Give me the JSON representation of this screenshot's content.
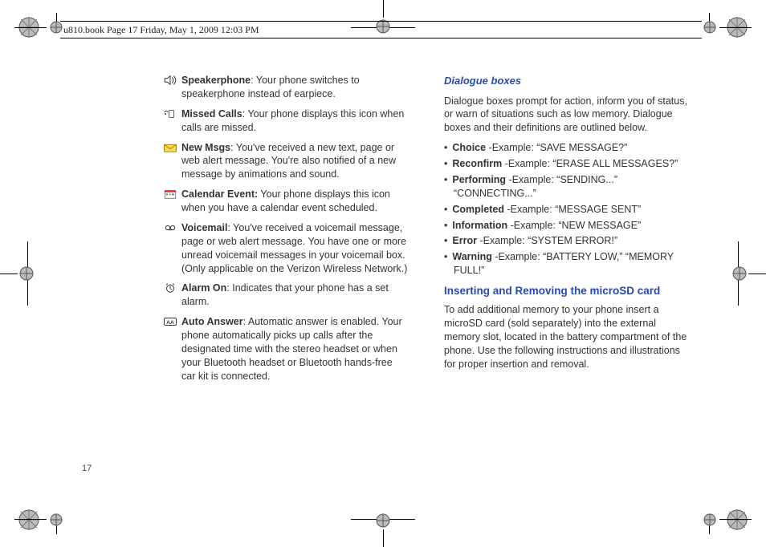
{
  "header": {
    "text": "u810.book  Page 17  Friday, May 1, 2009  12:03 PM"
  },
  "pagenum": "17",
  "left": {
    "items": [
      {
        "name": "speakerphone",
        "label": "Speakerphone",
        "sep": ": ",
        "text": "Your phone switches to speakerphone instead of earpiece."
      },
      {
        "name": "missed-calls",
        "label": "Missed Calls",
        "sep": ": ",
        "text": "Your phone displays this icon when calls are missed."
      },
      {
        "name": "new-msgs",
        "label": "New Msgs",
        "sep": ": ",
        "text": "You've received a new text, page or web alert message. You're also notified of a new message by animations and sound."
      },
      {
        "name": "calendar-event",
        "label": "Calendar Event:",
        "sep": " ",
        "text": "Your phone displays this icon when you have a calendar event scheduled."
      },
      {
        "name": "voicemail",
        "label": "Voicemail",
        "sep": ": ",
        "text": "You've received a voicemail message, page or web alert message. You have one or more unread voicemail messages in your voicemail box. (Only applicable on the Verizon Wireless Network.)"
      },
      {
        "name": "alarm-on",
        "label": "Alarm On",
        "sep": ": ",
        "text": "Indicates that your phone has a set alarm."
      },
      {
        "name": "auto-answer",
        "label": "Auto Answer",
        "sep": ": ",
        "text": "Automatic answer is enabled. Your phone automatically picks up calls after the designated time with the stereo headset or when your Bluetooth headset or Bluetooth hands-free car kit is connected."
      }
    ]
  },
  "right": {
    "heading1": "Dialogue boxes",
    "intro": "Dialogue boxes prompt for action, inform you of status, or warn of situations such as low memory. Dialogue boxes and their definitions are outlined below.",
    "bullets": [
      {
        "label": "Choice",
        "text": " -Example: “SAVE MESSAGE?”"
      },
      {
        "label": "Reconfirm",
        "text": " -Example: “ERASE ALL MESSAGES?”"
      },
      {
        "label": "Performing",
        "text": " -Example: “SENDING...” “CONNECTING...”"
      },
      {
        "label": "Completed",
        "text": " -Example: “MESSAGE SENT”"
      },
      {
        "label": "Information",
        "text": " -Example: “NEW MESSAGE”"
      },
      {
        "label": "Error",
        "text": " -Example: “SYSTEM ERROR!”"
      },
      {
        "label": "Warning",
        "text": " -Example: “BATTERY LOW,” “MEMORY FULL!”"
      }
    ],
    "heading2": "Inserting and Removing the microSD card",
    "para2": "To add additional memory to your phone insert a microSD card (sold separately) into the external memory slot, located in the battery compartment of the phone. Use the following instructions and illustrations for proper insertion and removal."
  }
}
